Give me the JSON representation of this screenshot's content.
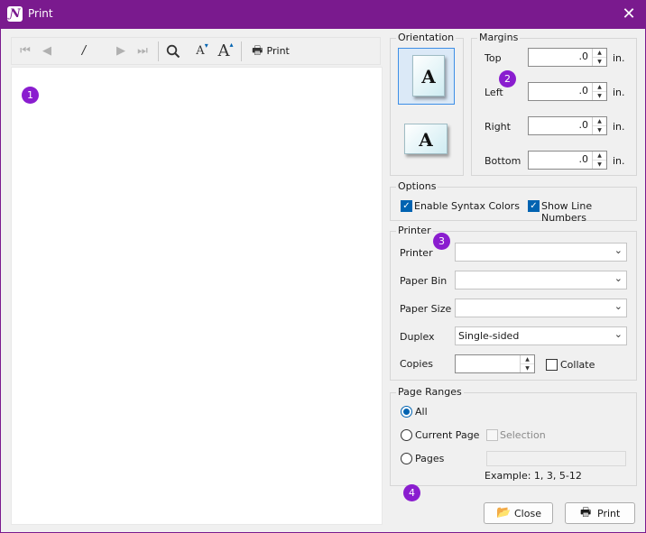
{
  "window": {
    "title": "Print",
    "app_icon": "app-logo-icon",
    "close_icon": "close-icon"
  },
  "preview_toolbar": {
    "first_page_icon": "first-page-icon",
    "prev_page_icon": "prev-page-icon",
    "page_separator": "/",
    "next_page_icon": "next-page-icon",
    "last_page_icon": "last-page-icon",
    "zoom_icon": "search-icon",
    "font_smaller_icon": "font-decrease-icon",
    "font_larger_icon": "font-increase-icon",
    "print_label": "Print"
  },
  "badges": {
    "b1": "1",
    "b2": "2",
    "b3": "3",
    "b4": "4"
  },
  "orientation": {
    "title": "Orientation",
    "selected": "portrait",
    "letter": "A"
  },
  "margins": {
    "title": "Margins",
    "unit": "in.",
    "top": {
      "label": "Top",
      "value": ".0"
    },
    "left": {
      "label": "Left",
      "value": ".0"
    },
    "right": {
      "label": "Right",
      "value": ".0"
    },
    "bottom": {
      "label": "Bottom",
      "value": ".0"
    }
  },
  "options": {
    "title": "Options",
    "syntax_colors": {
      "label": "Enable Syntax Colors",
      "checked": true
    },
    "line_numbers": {
      "label": "Show Line Numbers",
      "checked": true
    }
  },
  "printer": {
    "title": "Printer",
    "printer_label": "Printer",
    "printer_value": "",
    "paper_bin_label": "Paper Bin",
    "paper_bin_value": "",
    "paper_size_label": "Paper Size",
    "paper_size_value": "",
    "duplex_label": "Duplex",
    "duplex_value": "Single-sided",
    "copies_label": "Copies",
    "copies_value": "",
    "collate_label": "Collate",
    "collate_checked": false
  },
  "page_ranges": {
    "title": "Page Ranges",
    "all_label": "All",
    "current_page_label": "Current Page",
    "selection_label": "Selection",
    "pages_label": "Pages",
    "example_text": "Example: 1, 3, 5-12",
    "selected": "all"
  },
  "buttons": {
    "close_label": "Close",
    "print_label": "Print"
  },
  "colors": {
    "titlebar": "#7a1a8e",
    "badge": "#8a1dcf",
    "accent": "#0063b1"
  }
}
